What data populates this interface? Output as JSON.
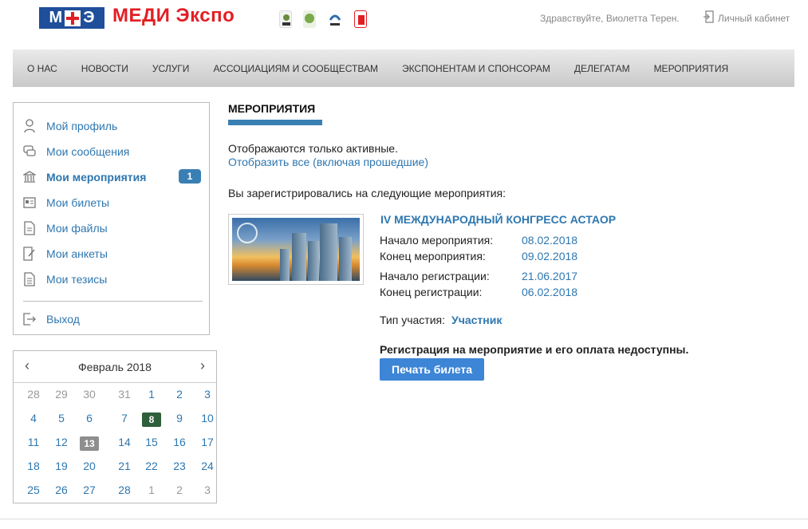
{
  "header": {
    "logo_mark": "М✚Э",
    "logo_letters": [
      "М",
      "Э"
    ],
    "logo_text": "МЕДИ Экспо",
    "partners": [
      "ufi-icon",
      "partner-green-icon",
      "partner-blue-icon",
      "partner-red-icon"
    ],
    "greeting": "Здравствуйте, Виолетта Терен.",
    "cabinet_label": "Личный кабинет"
  },
  "nav": {
    "items": [
      "О НАС",
      "НОВОСТИ",
      "УСЛУГИ",
      "АССОЦИАЦИЯМ И СООБЩЕСТВАМ",
      "ЭКСПОНЕНТАМ И СПОНСОРАМ",
      "ДЕЛЕГАТАМ",
      "МЕРОПРИЯТИЯ"
    ]
  },
  "sidebar": {
    "items": [
      {
        "label": "Мой профиль",
        "icon": "user-icon"
      },
      {
        "label": "Мои сообщения",
        "icon": "chat-icon"
      },
      {
        "label": "Мои мероприятия",
        "icon": "building-icon",
        "active": true,
        "badge": "1"
      },
      {
        "label": "Мои билеты",
        "icon": "ticket-icon"
      },
      {
        "label": "Мои файлы",
        "icon": "file-icon"
      },
      {
        "label": "Мои анкеты",
        "icon": "form-icon"
      },
      {
        "label": "Мои тезисы",
        "icon": "document-icon"
      }
    ],
    "logout": "Выход"
  },
  "calendar": {
    "month": "Февраль 2018",
    "prev": "‹",
    "next": "›",
    "weeks": [
      [
        "28",
        "29",
        "30",
        "31",
        "1",
        "2",
        "3"
      ],
      [
        "4",
        "5",
        "6",
        "7",
        "8",
        "9",
        "10"
      ],
      [
        "11",
        "12",
        "13",
        "14",
        "15",
        "16",
        "17"
      ],
      [
        "18",
        "19",
        "20",
        "21",
        "22",
        "23",
        "24"
      ],
      [
        "25",
        "26",
        "27",
        "28",
        "1",
        "2",
        "3"
      ]
    ],
    "today": "8",
    "highlighted": "13"
  },
  "main": {
    "title": "МЕРОПРИЯТИЯ",
    "active_note": "Отображаются только активные.",
    "show_all": "Отобразить все (включая прошедшие)",
    "registered_text": "Вы зарегистрировались на следующие мероприятия:",
    "event": {
      "title": "IV МЕЖДУНАРОДНЫЙ КОНГРЕСС АСТАОР",
      "fields": [
        {
          "label": "Начало мероприятия:",
          "value": "08.02.2018"
        },
        {
          "label": "Конец мероприятия:",
          "value": "09.02.2018"
        },
        {
          "label": "Начало регистрации:",
          "value": "21.06.2017"
        },
        {
          "label": "Конец регистрации:",
          "value": "06.02.2018"
        }
      ],
      "type_label": "Тип участия:",
      "type_value": "Участник",
      "unavailable": "Регистрация на мероприятие и его оплата недоступны.",
      "print_button": "Печать билета"
    }
  },
  "colors": {
    "accent": "#2e77b0",
    "brand_red": "#e31e24",
    "brand_blue": "#1f4e9a",
    "button": "#3d85d6",
    "today_bg": "#2e5e3a"
  }
}
